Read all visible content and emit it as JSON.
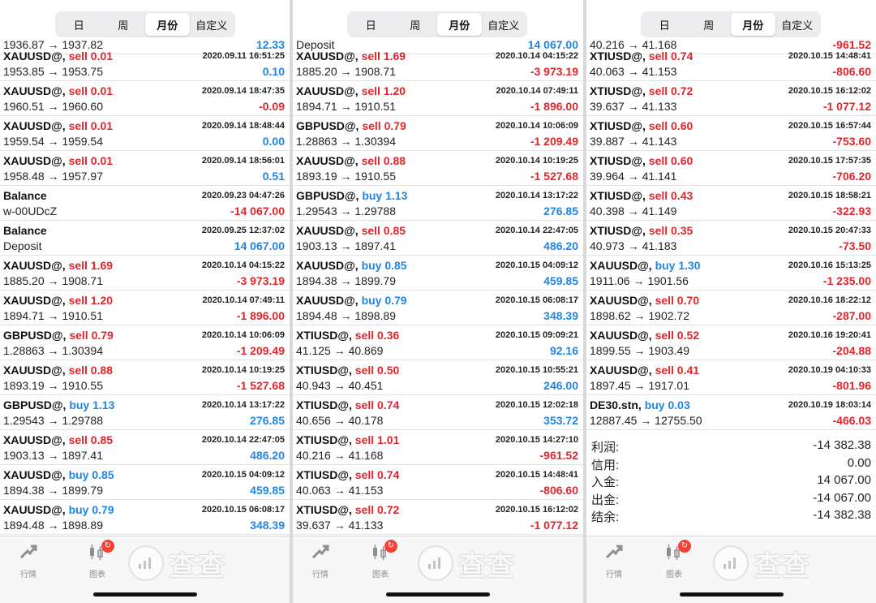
{
  "segment": [
    "日",
    "周",
    "月份",
    "自定义"
  ],
  "active_segment": 2,
  "tabs": {
    "quotes": "行情",
    "chart": "图表"
  },
  "watermark": "查查",
  "summary_labels": [
    "利润:",
    "信用:",
    "入金:",
    "出金:",
    "结余:"
  ],
  "panels": [
    {
      "top_partial": {
        "prices": "1936.87 → 1937.82",
        "profit": "12.33"
      },
      "rows": [
        {
          "symbol": "XAUUSD@,",
          "side": "sell",
          "lot": "sell 0.01",
          "date": "2020.09.11 16:51:25",
          "prices": "1953.85 → 1953.75",
          "profit": "0.10"
        },
        {
          "symbol": "XAUUSD@,",
          "side": "sell",
          "lot": "sell 0.01",
          "date": "2020.09.14 18:47:35",
          "prices": "1960.51 → 1960.60",
          "profit": "-0.09"
        },
        {
          "symbol": "XAUUSD@,",
          "side": "sell",
          "lot": "sell 0.01",
          "date": "2020.09.14 18:48:44",
          "prices": "1959.54 → 1959.54",
          "profit": "0.00"
        },
        {
          "symbol": "XAUUSD@,",
          "side": "sell",
          "lot": "sell 0.01",
          "date": "2020.09.14 18:56:01",
          "prices": "1958.48 → 1957.97",
          "profit": "0.51"
        },
        {
          "symbol": "Balance",
          "side": "none",
          "lot": "",
          "date": "2020.09.23 04:47:26",
          "prices": "w-00UDcZ",
          "profit": "-14 067.00"
        },
        {
          "symbol": "Balance",
          "side": "none",
          "lot": "",
          "date": "2020.09.25 12:37:02",
          "prices": "Deposit",
          "profit": "14 067.00"
        },
        {
          "symbol": "XAUUSD@,",
          "side": "sell",
          "lot": "sell 1.69",
          "date": "2020.10.14 04:15:22",
          "prices": "1885.20 → 1908.71",
          "profit": "-3 973.19"
        },
        {
          "symbol": "XAUUSD@,",
          "side": "sell",
          "lot": "sell 1.20",
          "date": "2020.10.14 07:49:11",
          "prices": "1894.71 → 1910.51",
          "profit": "-1 896.00"
        },
        {
          "symbol": "GBPUSD@,",
          "side": "sell",
          "lot": "sell 0.79",
          "date": "2020.10.14 10:06:09",
          "prices": "1.28863 → 1.30394",
          "profit": "-1 209.49"
        },
        {
          "symbol": "XAUUSD@,",
          "side": "sell",
          "lot": "sell 0.88",
          "date": "2020.10.14 10:19:25",
          "prices": "1893.19 → 1910.55",
          "profit": "-1 527.68"
        },
        {
          "symbol": "GBPUSD@,",
          "side": "buy",
          "lot": "buy 1.13",
          "date": "2020.10.14 13:17:22",
          "prices": "1.29543 → 1.29788",
          "profit": "276.85"
        },
        {
          "symbol": "XAUUSD@,",
          "side": "sell",
          "lot": "sell 0.85",
          "date": "2020.10.14 22:47:05",
          "prices": "1903.13 → 1897.41",
          "profit": "486.20"
        },
        {
          "symbol": "XAUUSD@,",
          "side": "buy",
          "lot": "buy 0.85",
          "date": "2020.10.15 04:09:12",
          "prices": "1894.38 → 1899.79",
          "profit": "459.85"
        },
        {
          "symbol": "XAUUSD@,",
          "side": "buy",
          "lot": "buy 0.79",
          "date": "2020.10.15 06:08:17",
          "prices": "1894.48 → 1898.89",
          "profit": "348.39"
        }
      ],
      "summary": []
    },
    {
      "top_partial": {
        "prices": "Deposit",
        "profit": "14 067.00"
      },
      "rows": [
        {
          "symbol": "XAUUSD@,",
          "side": "sell",
          "lot": "sell 1.69",
          "date": "2020.10.14 04:15:22",
          "prices": "1885.20 → 1908.71",
          "profit": "-3 973.19"
        },
        {
          "symbol": "XAUUSD@,",
          "side": "sell",
          "lot": "sell 1.20",
          "date": "2020.10.14 07:49:11",
          "prices": "1894.71 → 1910.51",
          "profit": "-1 896.00"
        },
        {
          "symbol": "GBPUSD@,",
          "side": "sell",
          "lot": "sell 0.79",
          "date": "2020.10.14 10:06:09",
          "prices": "1.28863 → 1.30394",
          "profit": "-1 209.49"
        },
        {
          "symbol": "XAUUSD@,",
          "side": "sell",
          "lot": "sell 0.88",
          "date": "2020.10.14 10:19:25",
          "prices": "1893.19 → 1910.55",
          "profit": "-1 527.68"
        },
        {
          "symbol": "GBPUSD@,",
          "side": "buy",
          "lot": "buy 1.13",
          "date": "2020.10.14 13:17:22",
          "prices": "1.29543 → 1.29788",
          "profit": "276.85"
        },
        {
          "symbol": "XAUUSD@,",
          "side": "sell",
          "lot": "sell 0.85",
          "date": "2020.10.14 22:47:05",
          "prices": "1903.13 → 1897.41",
          "profit": "486.20"
        },
        {
          "symbol": "XAUUSD@,",
          "side": "buy",
          "lot": "buy 0.85",
          "date": "2020.10.15 04:09:12",
          "prices": "1894.38 → 1899.79",
          "profit": "459.85"
        },
        {
          "symbol": "XAUUSD@,",
          "side": "buy",
          "lot": "buy 0.79",
          "date": "2020.10.15 06:08:17",
          "prices": "1894.48 → 1898.89",
          "profit": "348.39"
        },
        {
          "symbol": "XTIUSD@,",
          "side": "sell",
          "lot": "sell 0.36",
          "date": "2020.10.15 09:09:21",
          "prices": "41.125 → 40.869",
          "profit": "92.16"
        },
        {
          "symbol": "XTIUSD@,",
          "side": "sell",
          "lot": "sell 0.50",
          "date": "2020.10.15 10:55:21",
          "prices": "40.943 → 40.451",
          "profit": "246.00"
        },
        {
          "symbol": "XTIUSD@,",
          "side": "sell",
          "lot": "sell 0.74",
          "date": "2020.10.15 12:02:18",
          "prices": "40.656 → 40.178",
          "profit": "353.72"
        },
        {
          "symbol": "XTIUSD@,",
          "side": "sell",
          "lot": "sell 1.01",
          "date": "2020.10.15 14:27:10",
          "prices": "40.216 → 41.168",
          "profit": "-961.52"
        },
        {
          "symbol": "XTIUSD@,",
          "side": "sell",
          "lot": "sell 0.74",
          "date": "2020.10.15 14:48:41",
          "prices": "40.063 → 41.153",
          "profit": "-806.60"
        },
        {
          "symbol": "XTIUSD@,",
          "side": "sell",
          "lot": "sell 0.72",
          "date": "2020.10.15 16:12:02",
          "prices": "39.637 → 41.133",
          "profit": "-1 077.12"
        }
      ],
      "summary": []
    },
    {
      "top_partial": {
        "prices": "40.216 → 41.168",
        "profit": "-961.52"
      },
      "rows": [
        {
          "symbol": "XTIUSD@,",
          "side": "sell",
          "lot": "sell 0.74",
          "date": "2020.10.15 14:48:41",
          "prices": "40.063 → 41.153",
          "profit": "-806.60"
        },
        {
          "symbol": "XTIUSD@,",
          "side": "sell",
          "lot": "sell 0.72",
          "date": "2020.10.15 16:12:02",
          "prices": "39.637 → 41.133",
          "profit": "-1 077.12"
        },
        {
          "symbol": "XTIUSD@,",
          "side": "sell",
          "lot": "sell 0.60",
          "date": "2020.10.15 16:57:44",
          "prices": "39.887 → 41.143",
          "profit": "-753.60"
        },
        {
          "symbol": "XTIUSD@,",
          "side": "sell",
          "lot": "sell 0.60",
          "date": "2020.10.15 17:57:35",
          "prices": "39.964 → 41.141",
          "profit": "-706.20"
        },
        {
          "symbol": "XTIUSD@,",
          "side": "sell",
          "lot": "sell 0.43",
          "date": "2020.10.15 18:58:21",
          "prices": "40.398 → 41.149",
          "profit": "-322.93"
        },
        {
          "symbol": "XTIUSD@,",
          "side": "sell",
          "lot": "sell 0.35",
          "date": "2020.10.15 20:47:33",
          "prices": "40.973 → 41.183",
          "profit": "-73.50"
        },
        {
          "symbol": "XAUUSD@,",
          "side": "buy",
          "lot": "buy 1.30",
          "date": "2020.10.16 15:13:25",
          "prices": "1911.06 → 1901.56",
          "profit": "-1 235.00"
        },
        {
          "symbol": "XAUUSD@,",
          "side": "sell",
          "lot": "sell 0.70",
          "date": "2020.10.16 18:22:12",
          "prices": "1898.62 → 1902.72",
          "profit": "-287.00"
        },
        {
          "symbol": "XAUUSD@,",
          "side": "sell",
          "lot": "sell 0.52",
          "date": "2020.10.16 19:20:41",
          "prices": "1899.55 → 1903.49",
          "profit": "-204.88"
        },
        {
          "symbol": "XAUUSD@,",
          "side": "sell",
          "lot": "sell 0.41",
          "date": "2020.10.19 04:10:33",
          "prices": "1897.45 → 1917.01",
          "profit": "-801.96"
        },
        {
          "symbol": "DE30.stn,",
          "side": "buy",
          "lot": "buy 0.03",
          "date": "2020.10.19 18:03:14",
          "prices": "12887.45 → 12755.50",
          "profit": "-466.03"
        }
      ],
      "summary": [
        "-14 382.38",
        "0.00",
        "14 067.00",
        "-14 067.00",
        "-14 382.38"
      ]
    }
  ]
}
